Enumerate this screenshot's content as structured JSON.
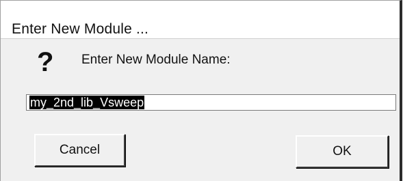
{
  "dialog": {
    "title": "Enter New Module ...",
    "prompt": "Enter New Module Name:",
    "question_icon": "question-mark-icon",
    "input_value": "my_2nd_lib_Vsweep",
    "cancel_label": "Cancel",
    "ok_label": "OK"
  }
}
